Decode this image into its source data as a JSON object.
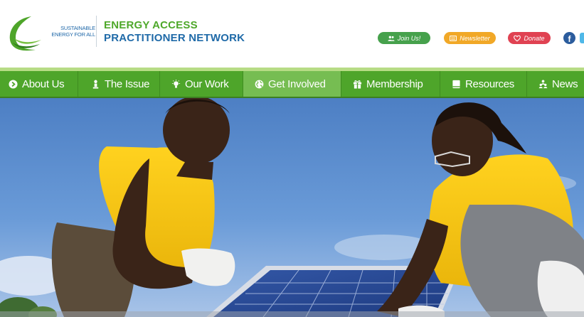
{
  "header": {
    "logo": {
      "text_line1": "SUSTAINABLE",
      "text_line2": "ENERGY FOR ALL"
    },
    "title_line1": "ENERGY ACCESS",
    "title_line2": "PRACTITIONER NETWORK",
    "actions": [
      {
        "label": "Join Us!",
        "icon": "users-icon",
        "color": "#46a14c"
      },
      {
        "label": "Newsletter",
        "icon": "newsletter-icon",
        "color": "#f1a827"
      },
      {
        "label": "Donate",
        "icon": "heart-icon",
        "color": "#e04252"
      }
    ],
    "social": {
      "facebook_glyph": "f",
      "icon": "facebook-icon"
    }
  },
  "nav": {
    "items": [
      {
        "label": "About Us",
        "icon": "arrow-circle-icon"
      },
      {
        "label": "The Issue",
        "icon": "person-icon"
      },
      {
        "label": "Our Work",
        "icon": "lightbulb-icon"
      },
      {
        "label": "Get Involved",
        "icon": "globe-icon",
        "active": true
      },
      {
        "label": "Membership",
        "icon": "gift-icon"
      },
      {
        "label": "Resources",
        "icon": "book-icon"
      },
      {
        "label": "News",
        "icon": "people-icon"
      }
    ],
    "colors": {
      "background": "#4ea52a",
      "active": "#76bd52"
    }
  },
  "hero": {
    "image": "photo of two people in yellow t-shirts installing a solar panel on a rooftop under a blue sky"
  }
}
